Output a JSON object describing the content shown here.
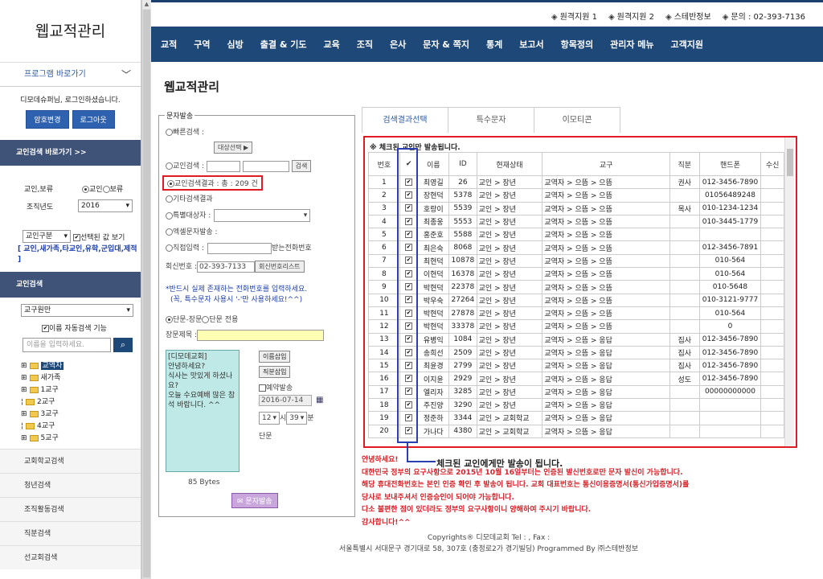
{
  "app_title": "웹교적관리",
  "topbar": {
    "links": [
      {
        "icon": "link-icon",
        "label": "원격지원 1"
      },
      {
        "icon": "link-icon",
        "label": "원격지원 2"
      },
      {
        "icon": "monitor-icon",
        "label": "스테반정보"
      },
      {
        "icon": "location-icon",
        "label": "문의 : 02-393-7136"
      }
    ]
  },
  "nav": {
    "items": [
      "교적",
      "구역",
      "심방",
      "출결 & 기도",
      "교육",
      "조직",
      "은사",
      "문자 & 쪽지",
      "통계",
      "보고서",
      "항목정의",
      "관리자 메뉴",
      "고객지원"
    ]
  },
  "sidebar": {
    "title": "웹교적관리",
    "program_shortcut": "프로그램 바로가기",
    "login_msg": "디모데슈퍼님, 로그인하셨습니다.",
    "pw_change": "암호변경",
    "logout": "로그아웃",
    "search_shortcut": "교인검색 바로가기 >>",
    "filter_label": "교인,보류",
    "radio_member": "교인",
    "radio_hold": "보류",
    "year_label": "조직년도",
    "year_value": "2016",
    "type_select": "교인구분",
    "show_selected": "선택된 값 보기",
    "type_hint": "[ 교인,새가족,타교인,유학,군입대,제적 ]",
    "member_search": "교인검색",
    "district_select": "교구원만",
    "auto_search": "이름 자동검색 기능",
    "name_placeholder": "이름을 입력하세요.",
    "tree": [
      "교역자",
      "새가족",
      "1교구",
      "2교구",
      "3교구",
      "4교구",
      "5교구"
    ],
    "bottom_links": [
      "교회학교검색",
      "청년검색",
      "조직활동검색",
      "직분검색",
      "선교회검색"
    ]
  },
  "main": {
    "page_title": "웹교적관리",
    "sms": {
      "legend": "문자발송",
      "quick_search": "빠른검색 :",
      "target_select": "대상선택 ▶",
      "member_search": "교인검색 :",
      "search_btn": "검색",
      "result_label": "교인검색결과 : 총 : 209 건",
      "other_result": "기타검색결과",
      "special_target": "특별대상자 :",
      "excel": "엑셀문자발송 :",
      "direct": "직접입력 :",
      "receive_phone": "받는전화번호",
      "return_no_label": "회신번호 :",
      "return_no": "02-393-7133",
      "return_list_btn": "회신번호리스트",
      "notice1": "*반드시 실제 존재하는 전화번호를 입력하세요.",
      "notice2": "(꼭, 특수문자 사용시 '-'만 사용하세요!^^)",
      "short_long": "단문-장문",
      "short_only": "단문 전용",
      "long_title": "장문제목 :",
      "message": "[디모데교회]\n안녕하세요?\n식사는 맛있게 하셨나요?\n오늘 수요예배 많은 참석 바랍니다. ^^",
      "insert_name": "이름삽입",
      "insert_role": "직분삽입",
      "reserve": "예약발송",
      "date": "2016-07-14",
      "hour": "12",
      "hour_suffix": "시",
      "minute": "39",
      "minute_suffix": "분",
      "mode": "단문",
      "bytes": "85 Bytes",
      "send_btn": "문자발송"
    },
    "tabs": [
      "검색결과선택",
      "특수문자",
      "이모티콘"
    ],
    "result_note": "※ 체크된 교인만 발송됩니다.",
    "table": {
      "headers": [
        "번호",
        "✔",
        "이름",
        "ID",
        "현재상태",
        "교구",
        "직분",
        "핸드폰",
        "수신"
      ],
      "rows": [
        [
          "1",
          "✔",
          "최영길",
          "26",
          "교인 > 장년",
          "교역자 > 으뜸 > 으뜸",
          "권사",
          "012-3456-7890",
          ""
        ],
        [
          "2",
          "✔",
          "장현덕",
          "5378",
          "교인 > 장년",
          "교역자 > 으뜸 > 으뜸",
          "",
          "01056489248",
          ""
        ],
        [
          "3",
          "✔",
          "호랑이",
          "5539",
          "교인 > 장년",
          "교역자 > 으뜸 > 으뜸",
          "목사",
          "010-1234-1234",
          ""
        ],
        [
          "4",
          "✔",
          "최종웅",
          "5553",
          "교인 > 장년",
          "교역자 > 으뜸 > 으뜸",
          "",
          "010-3445-1779",
          ""
        ],
        [
          "5",
          "✔",
          "홍준호",
          "5588",
          "교인 > 장년",
          "교역자 > 으뜸 > 으뜸",
          "",
          "",
          ""
        ],
        [
          "6",
          "✔",
          "최은숙",
          "8068",
          "교인 > 장년",
          "교역자 > 으뜸 > 으뜸",
          "",
          "012-3456-7891",
          ""
        ],
        [
          "7",
          "✔",
          "최현덕",
          "10878",
          "교인 > 장년",
          "교역자 > 으뜸 > 으뜸",
          "",
          "010-564",
          ""
        ],
        [
          "8",
          "✔",
          "이현덕",
          "16378",
          "교인 > 장년",
          "교역자 > 으뜸 > 으뜸",
          "",
          "010-564",
          ""
        ],
        [
          "9",
          "✔",
          "박현덕",
          "22378",
          "교인 > 장년",
          "교역자 > 으뜸 > 으뜸",
          "",
          "010-5648",
          ""
        ],
        [
          "10",
          "✔",
          "박우숙",
          "27264",
          "교인 > 장년",
          "교역자 > 으뜸 > 으뜸",
          "",
          "010-3121-9777",
          ""
        ],
        [
          "11",
          "✔",
          "박현덕",
          "27878",
          "교인 > 장년",
          "교역자 > 으뜸 > 으뜸",
          "",
          "010-564",
          ""
        ],
        [
          "12",
          "✔",
          "박현덕",
          "33378",
          "교인 > 장년",
          "교역자 > 으뜸 > 으뜸",
          "",
          "0",
          ""
        ],
        [
          "13",
          "✔",
          "유병익",
          "1084",
          "교인 > 장년",
          "교역자 > 으뜸 > 응답",
          "집사",
          "012-3456-7890",
          ""
        ],
        [
          "14",
          "✔",
          "송희선",
          "2509",
          "교인 > 장년",
          "교역자 > 으뜸 > 응답",
          "집사",
          "012-3456-7890",
          ""
        ],
        [
          "15",
          "✔",
          "최윤경",
          "2799",
          "교인 > 장년",
          "교역자 > 으뜸 > 응답",
          "집사",
          "012-3456-7890",
          ""
        ],
        [
          "16",
          "✔",
          "이지윤",
          "2929",
          "교인 > 장년",
          "교역자 > 으뜸 > 응답",
          "성도",
          "012-3456-7890",
          ""
        ],
        [
          "17",
          "✔",
          "엘리자",
          "3285",
          "교인 > 장년",
          "교역자 > 으뜸 > 응답",
          "",
          "00000000000",
          ""
        ],
        [
          "18",
          "✔",
          "주진양",
          "3290",
          "교인 > 장년",
          "교역자 > 으뜸 > 응답",
          "",
          "",
          ""
        ],
        [
          "19",
          "✔",
          "정준하",
          "3344",
          "교인 > 교회학교",
          "교역자 > 으뜸 > 응답",
          "",
          "",
          ""
        ],
        [
          "20",
          "✔",
          "가나다",
          "4380",
          "교인 > 교회학교",
          "교역자 > 으뜸 > 응답",
          "",
          "",
          ""
        ]
      ]
    },
    "callout": "체크된 교인에게만 발송이 됩니다.",
    "notes": [
      "안녕하세요!",
      "대한민국 정부의 요구사항으로 2015년 10월 16일부터는 인증된 발신번호로만 문자 발신이 가능합니다.",
      "해당 휴대전화번호는 본인 인증 확인 후 발송이 됩니다. 교회 대표번호는 통신이용증명서(통신가입증명서)를",
      "당사로 보내주셔서 인증승인이 되어야 가능합니다.",
      "다소 불편한 점이 있더라도 정부의 요구사항이니 양해하여 주시기 바랍니다.",
      "감사합니다!^^"
    ],
    "footer1": "Copyrights® 디모데교회 Tel : , Fax :",
    "footer2": "서울특별시 서대문구 경기대로 58, 307호 (충정로2가 경기빌딩) Programmed By ㈜스테반정보"
  }
}
